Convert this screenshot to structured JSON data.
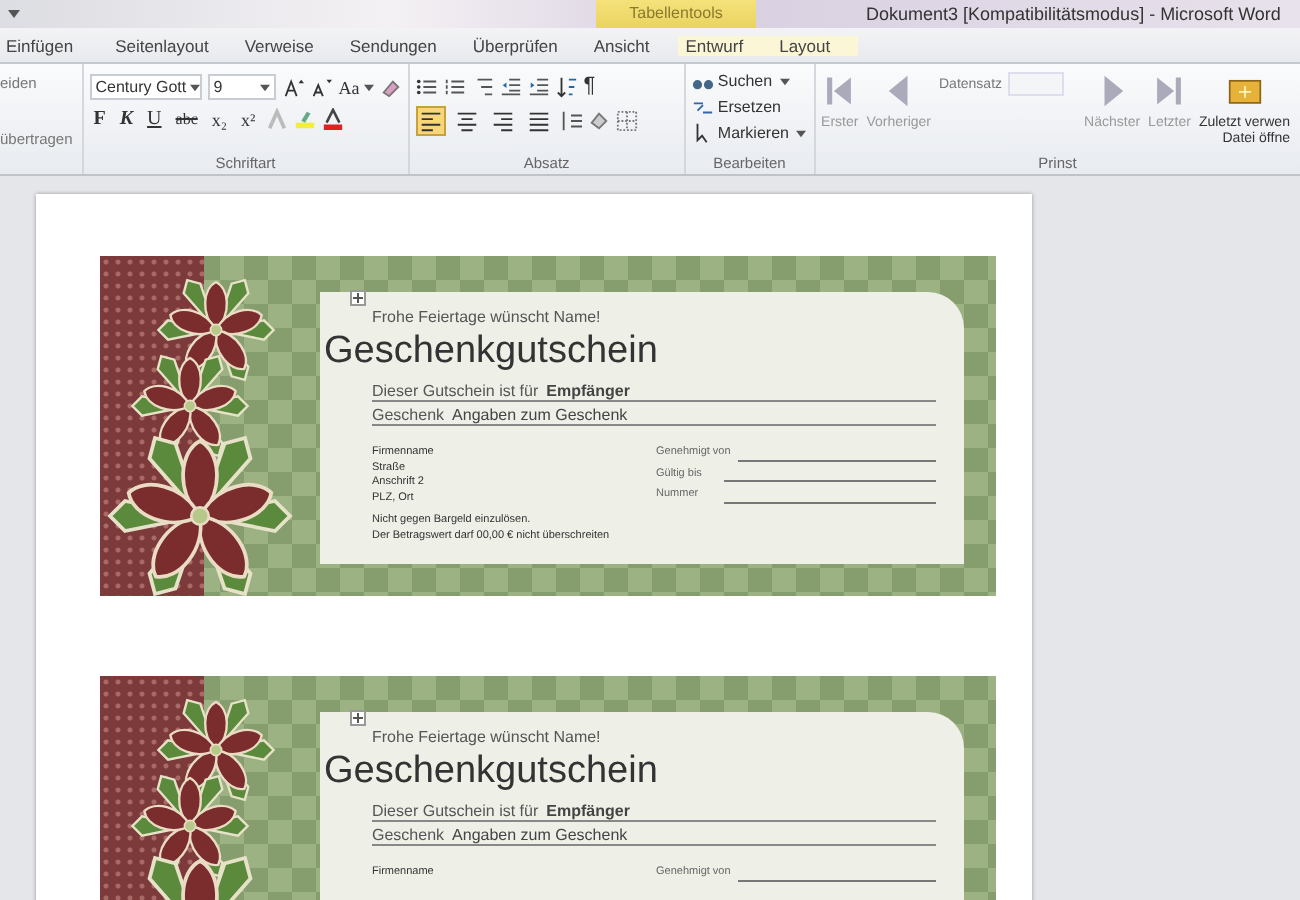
{
  "window": {
    "title": "Dokument3 [Kompatibilitätsmodus] - Microsoft Word",
    "context_tab_group": "Tabellentools"
  },
  "tabs": [
    {
      "label": "Einfügen",
      "selected": false,
      "context": false
    },
    {
      "label": "Seitenlayout",
      "selected": false,
      "context": false
    },
    {
      "label": "Verweise",
      "selected": false,
      "context": false
    },
    {
      "label": "Sendungen",
      "selected": false,
      "context": false
    },
    {
      "label": "Überprüfen",
      "selected": false,
      "context": false
    },
    {
      "label": "Ansicht",
      "selected": false,
      "context": false
    },
    {
      "label": "Entwurf",
      "selected": false,
      "context": true
    },
    {
      "label": "Layout",
      "selected": false,
      "context": true
    }
  ],
  "ribbon": {
    "clipboard": {
      "items": [
        "eiden",
        "übertragen"
      ]
    },
    "font": {
      "family": "Century Gott",
      "size": "9",
      "case_button": "Aa",
      "group_label": "Schriftart",
      "format_buttons": [
        {
          "label": "F",
          "kind": "bold"
        },
        {
          "label": "K",
          "kind": "italic"
        },
        {
          "label": "U",
          "kind": "underline"
        },
        {
          "label": "abc",
          "kind": "strike"
        },
        {
          "label": "x₂",
          "kind": "sub"
        },
        {
          "label": "x²",
          "kind": "super"
        }
      ]
    },
    "paragraph": {
      "group_label": "Absatz",
      "pilcrow": "¶",
      "alignments": [
        {
          "kind": "left",
          "selected": true
        },
        {
          "kind": "center",
          "selected": false
        },
        {
          "kind": "right",
          "selected": false
        },
        {
          "kind": "justify",
          "selected": false
        }
      ]
    },
    "editing": {
      "group_label": "Bearbeiten",
      "items": [
        {
          "label": "Suchen",
          "dropdown": true,
          "kind": "find"
        },
        {
          "label": "Ersetzen",
          "dropdown": false,
          "kind": "replace"
        },
        {
          "label": "Markieren",
          "dropdown": true,
          "kind": "select"
        }
      ]
    },
    "navigation": {
      "group_label": "Prinst",
      "record_label": "Datensatz",
      "buttons": [
        {
          "label": "Erster",
          "kind": "first"
        },
        {
          "label": "Vorheriger",
          "kind": "prev"
        },
        {
          "label": "Nächster",
          "kind": "next"
        },
        {
          "label": "Letzter",
          "kind": "last"
        }
      ],
      "recent": [
        "Zuletzt verwen",
        "Datei öffne"
      ]
    }
  },
  "vouchers": [
    {
      "greeting": "Frohe Feiertage wünscht Name!",
      "title": "Geschenkgutschein",
      "recipient_label": "Dieser Gutschein ist für",
      "recipient": "Empfänger",
      "gift_label": "Geschenk",
      "gift": "Angaben zum Geschenk",
      "address": [
        "Firmenname",
        "Straße",
        "Anschrift 2",
        "PLZ, Ort"
      ],
      "fields": [
        "Genehmigt von",
        "Gültig bis",
        "Nummer"
      ],
      "notes": [
        "Nicht gegen Bargeld einzulösen.",
        "Der Betragswert darf 00,00 € nicht überschreiten"
      ]
    },
    {
      "greeting": "Frohe Feiertage wünscht Name!",
      "title": "Geschenkgutschein",
      "recipient_label": "Dieser Gutschein ist für",
      "recipient": "Empfänger",
      "gift_label": "Geschenk",
      "gift": "Angaben zum Geschenk",
      "address": [
        "Firmenname"
      ],
      "fields": [
        "Genehmigt von"
      ]
    }
  ]
}
